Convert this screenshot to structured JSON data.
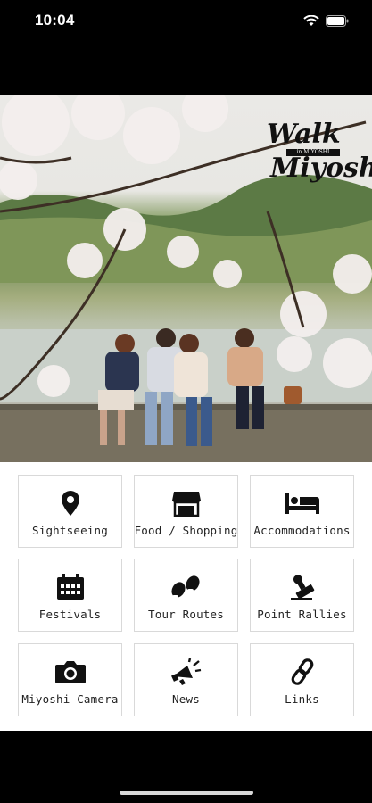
{
  "status_bar": {
    "time": "10:04",
    "icons": [
      "signal-icon",
      "wifi-icon",
      "battery-icon"
    ]
  },
  "hero": {
    "logo_lines": [
      "Walk",
      "Miyoshi"
    ],
    "logo_band_text": "in MIYOSHI"
  },
  "menu": {
    "items": [
      {
        "label": "Sightseeing",
        "icon": "map-pin-icon"
      },
      {
        "label": "Food / Shopping",
        "icon": "store-icon"
      },
      {
        "label": "Accommodations",
        "icon": "bed-icon"
      },
      {
        "label": "Festivals",
        "icon": "calendar-icon"
      },
      {
        "label": "Tour Routes",
        "icon": "footprints-icon"
      },
      {
        "label": "Point Rallies",
        "icon": "stamp-icon"
      },
      {
        "label": "Miyoshi Camera",
        "icon": "camera-icon"
      },
      {
        "label": "News",
        "icon": "megaphone-icon"
      },
      {
        "label": "Links",
        "icon": "link-icon"
      }
    ]
  },
  "colors": {
    "background": "#000000",
    "panel": "#ffffff",
    "tile_border": "#d9d9d9",
    "icon": "#111111"
  }
}
